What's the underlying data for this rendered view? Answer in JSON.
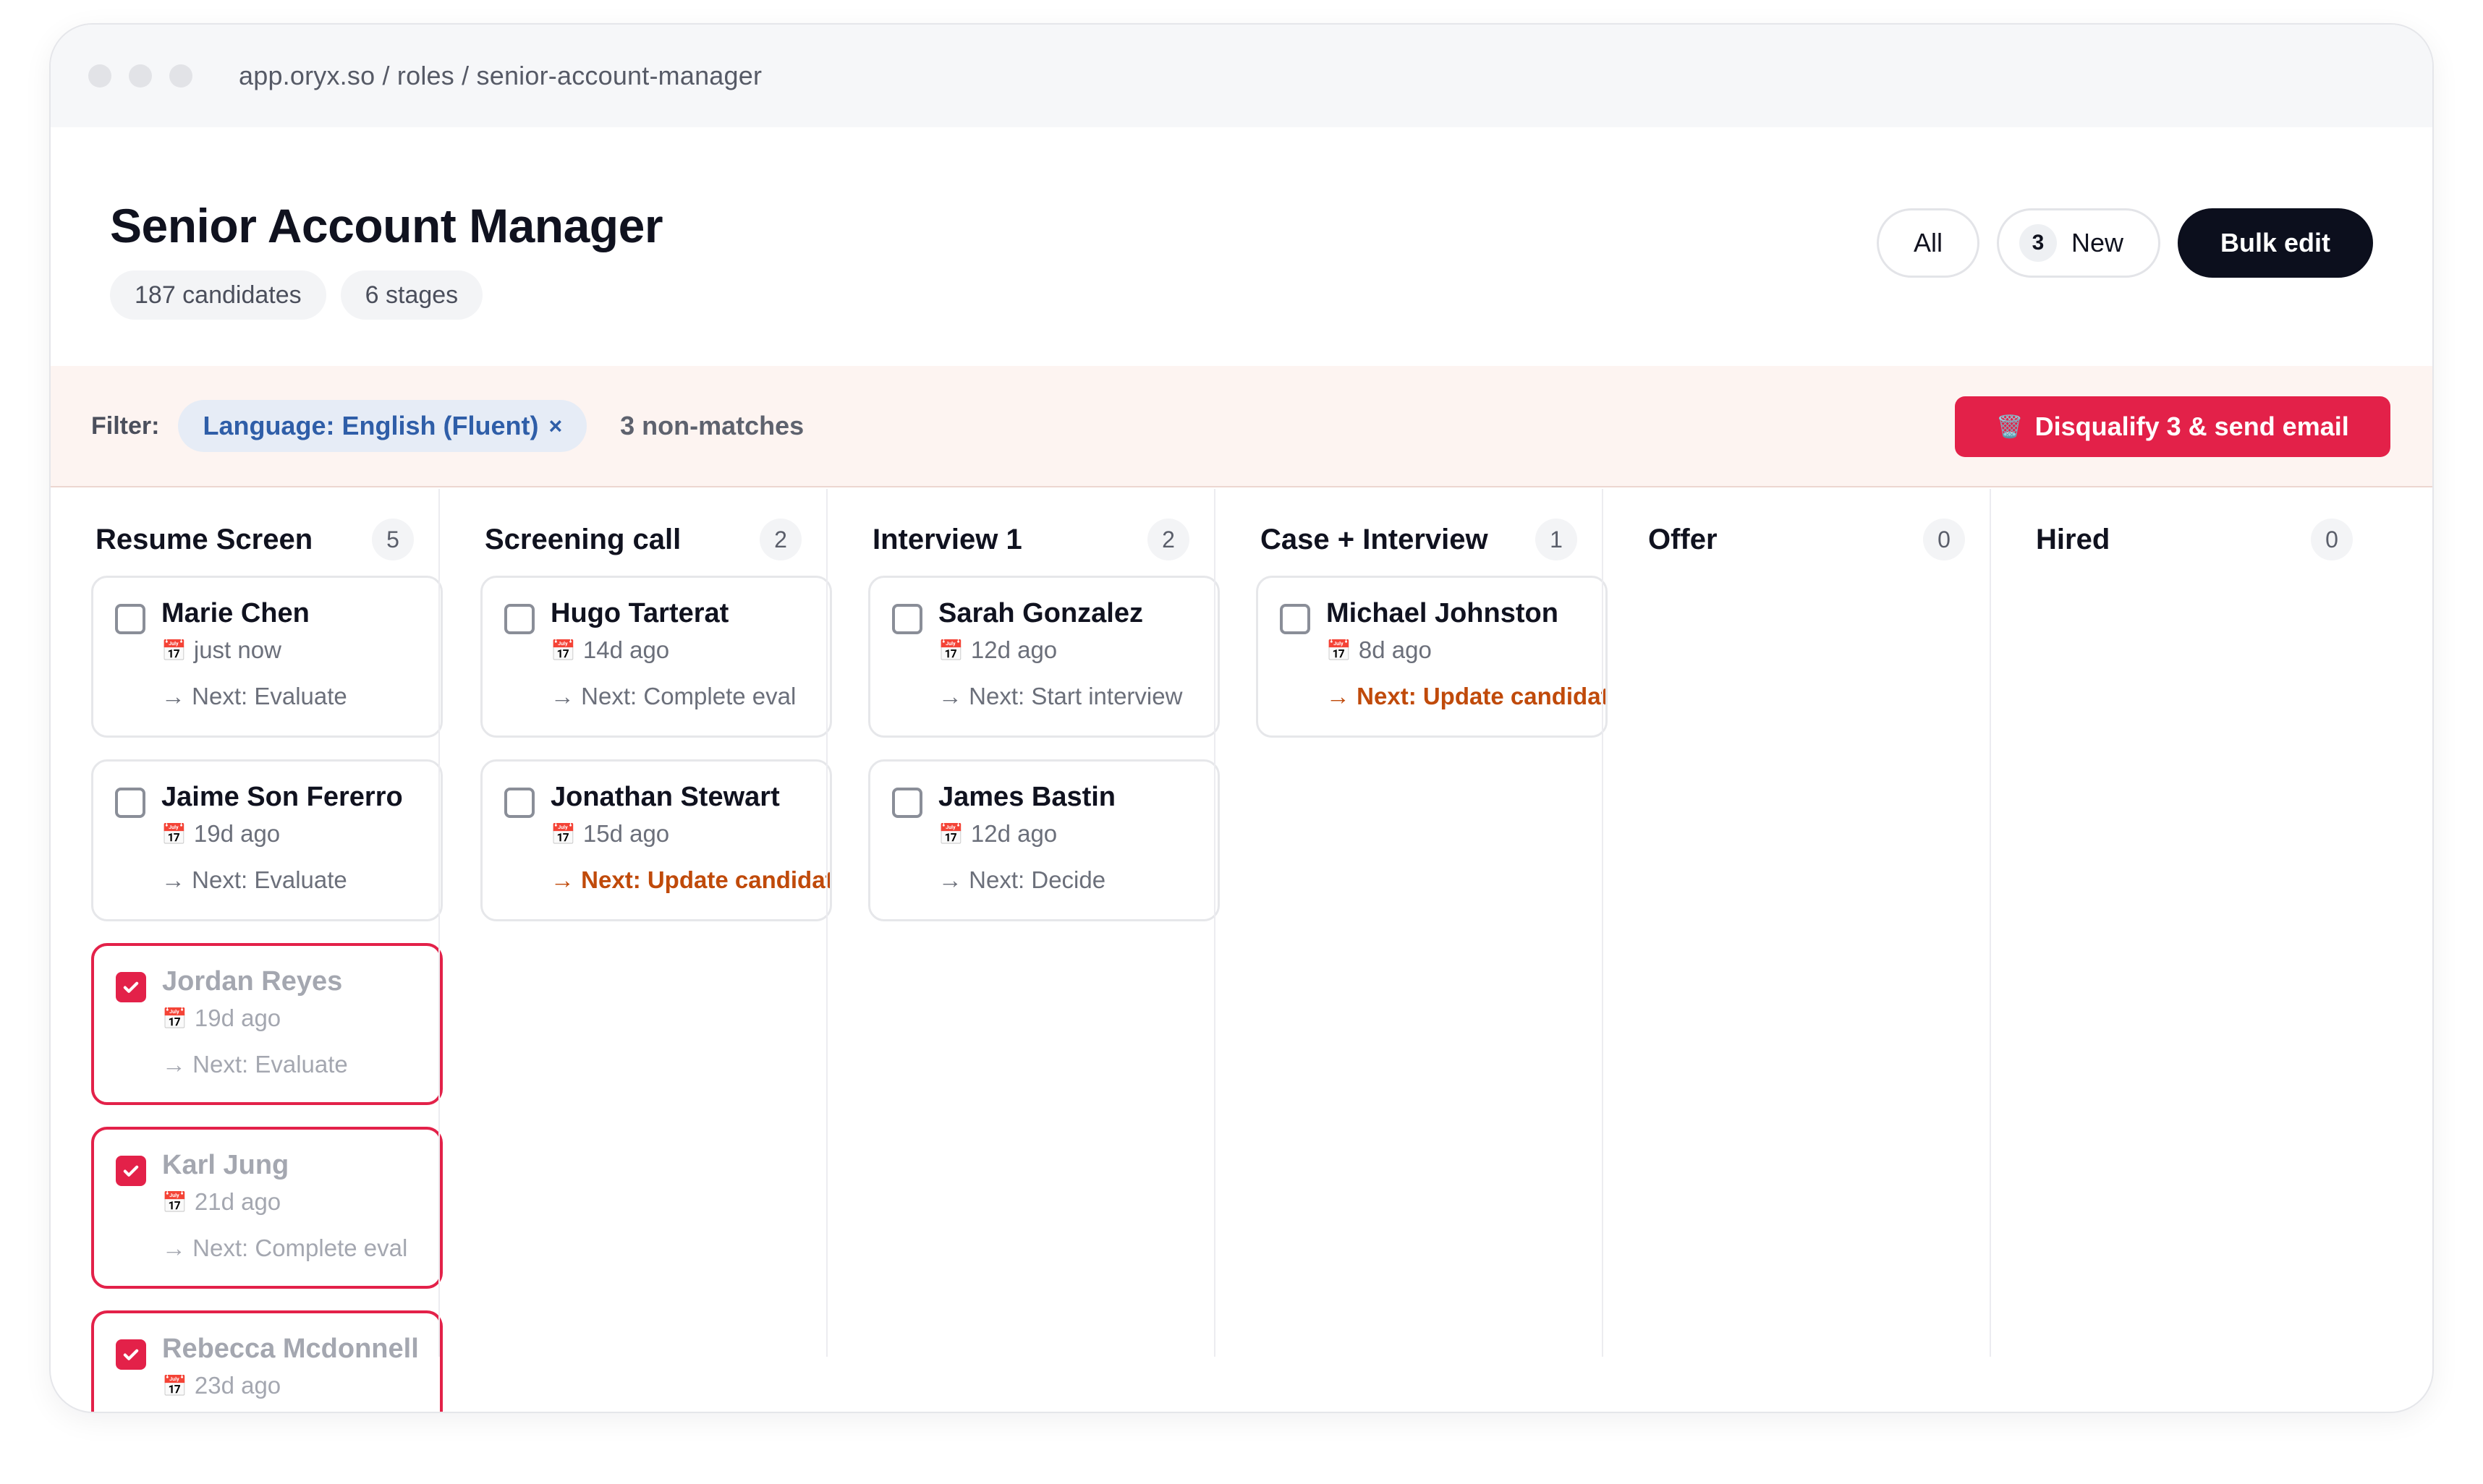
{
  "browser": {
    "url": "app.oryx.so / roles / senior-account-manager"
  },
  "header": {
    "title": "Senior Account Manager",
    "candidates_chip": "187 candidates",
    "stages_chip": "6 stages",
    "all_label": "All",
    "new_count": "3",
    "new_label": "New",
    "bulk_edit_label": "Bulk edit"
  },
  "filter": {
    "label": "Filter:",
    "tag": "Language: English (Fluent)",
    "tag_remove": "×",
    "nonmatches": "3 non-matches",
    "disqualify_label": "Disqualify 3 & send email"
  },
  "icons": {
    "calendar": "📅",
    "trash": "🗑️",
    "arrow": "→"
  },
  "colors": {
    "accent": "#e32149",
    "primary": "#0c0f1d",
    "warning_text": "#c04a0a",
    "filter_bg": "#fdf4f1",
    "tag_text": "#2f5ea8"
  },
  "columns": [
    {
      "title": "Resume Screen",
      "count": "5",
      "cards": [
        {
          "name": "Marie Chen",
          "time": "just now",
          "next": "→ Next: Evaluate",
          "checked": false,
          "warn": false
        },
        {
          "name": "Jaime Son Fererro",
          "time": "19d ago",
          "next": "→ Next: Evaluate",
          "checked": false,
          "warn": false
        },
        {
          "name": "Jordan Reyes",
          "time": "19d ago",
          "next": "→ Next: Evaluate",
          "checked": true,
          "warn": false
        },
        {
          "name": "Karl Jung",
          "time": "21d ago",
          "next": "→ Next: Complete eval",
          "checked": true,
          "warn": false
        },
        {
          "name": "Rebecca Mcdonnell",
          "time": "23d ago",
          "next": "",
          "checked": true,
          "warn": false
        }
      ]
    },
    {
      "title": "Screening call",
      "count": "2",
      "cards": [
        {
          "name": "Hugo Tarterat",
          "time": "14d ago",
          "next": "→ Next: Complete eval",
          "checked": false,
          "warn": false
        },
        {
          "name": "Jonathan Stewart",
          "time": "15d ago",
          "next": "→ Next: Update candidate",
          "checked": false,
          "warn": true
        }
      ]
    },
    {
      "title": "Interview 1",
      "count": "2",
      "cards": [
        {
          "name": "Sarah Gonzalez",
          "time": "12d ago",
          "next": "→ Next: Start interview",
          "checked": false,
          "warn": false
        },
        {
          "name": "James Bastin",
          "time": "12d ago",
          "next": "→ Next: Decide",
          "checked": false,
          "warn": false
        }
      ]
    },
    {
      "title": "Case + Interview",
      "count": "1",
      "cards": [
        {
          "name": "Michael Johnston",
          "time": "8d ago",
          "next": "→ Next: Update candidate",
          "checked": false,
          "warn": true
        }
      ]
    },
    {
      "title": "Offer",
      "count": "0",
      "cards": []
    },
    {
      "title": "Hired",
      "count": "0",
      "cards": []
    }
  ]
}
